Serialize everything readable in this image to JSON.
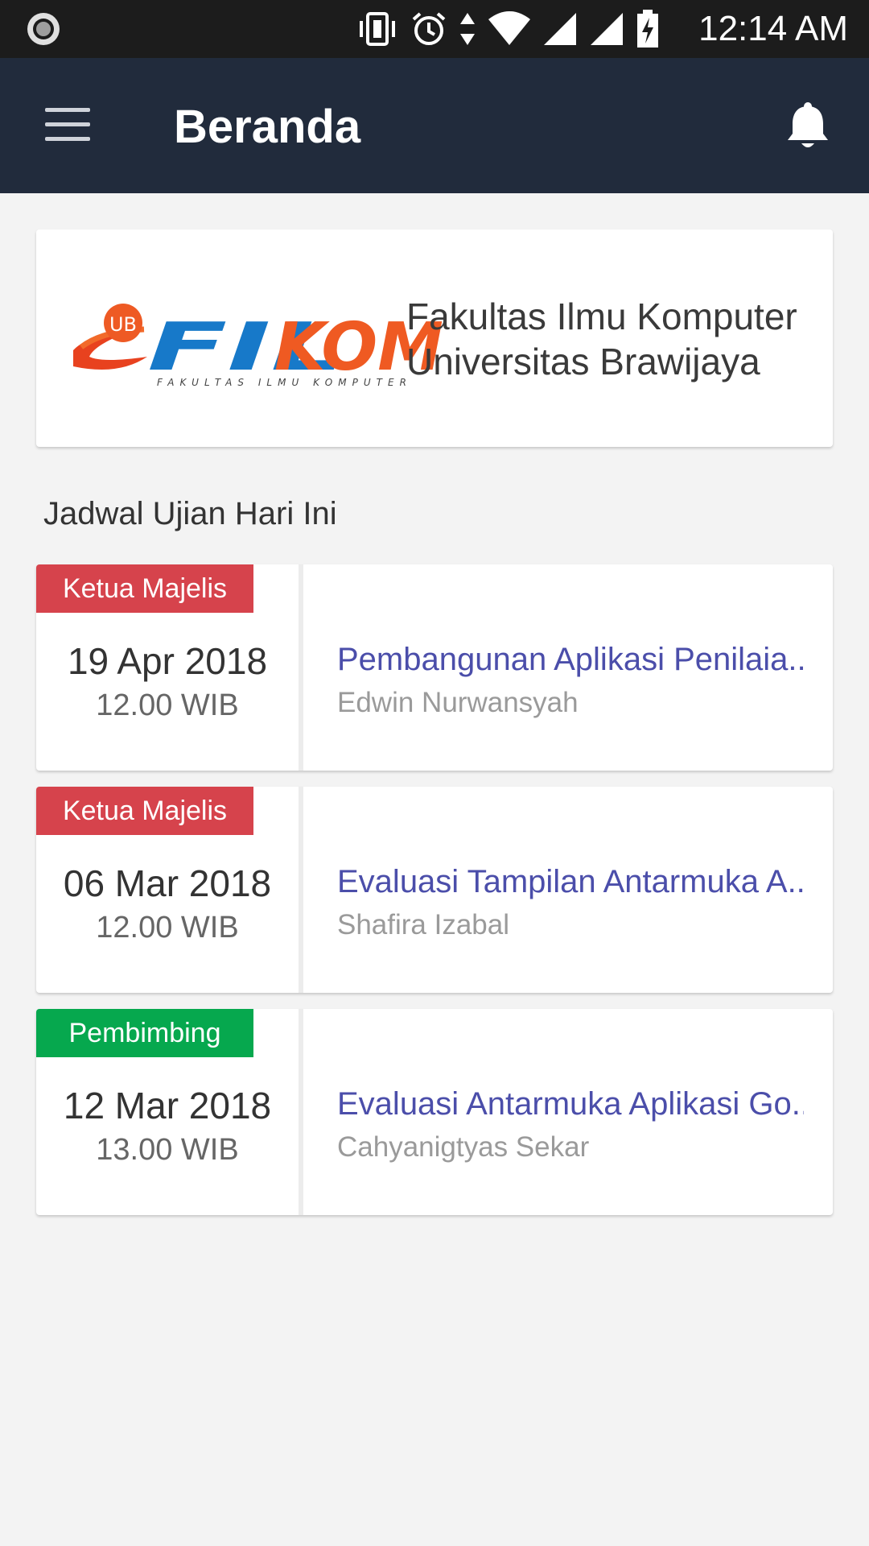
{
  "status_bar": {
    "time": "12:14 AM",
    "icons": [
      "record-icon",
      "vibrate-icon",
      "alarm-icon",
      "data-arrows-icon",
      "wifi-icon",
      "signal-icon",
      "signal-icon",
      "battery-charging-icon"
    ]
  },
  "app_bar": {
    "title": "Beranda",
    "menu_icon": "hamburger-menu-icon",
    "notification_icon": "bell-icon",
    "background": "#212b3c"
  },
  "banner": {
    "logo_text": "FILKOM",
    "logo_badge": "UB",
    "logo_subtext": "FAKULTAS ILMU KOMPUTER",
    "line1": "Fakultas Ilmu Komputer",
    "line2": "Universitas Brawijaya"
  },
  "section": {
    "title": "Jadwal Ujian Hari Ini"
  },
  "exams": [
    {
      "role": "Ketua Majelis",
      "role_color": "#d6434c",
      "date": "19 Apr 2018",
      "time": "12.00 WIB",
      "title": "Pembangunan Aplikasi Penilaia..",
      "name": "Edwin Nurwansyah"
    },
    {
      "role": "Ketua Majelis",
      "role_color": "#d6434c",
      "date": "06 Mar 2018",
      "time": "12.00 WIB",
      "title": "Evaluasi Tampilan Antarmuka A..",
      "name": "Shafira Izabal"
    },
    {
      "role": "Pembimbing",
      "role_color": "#06a84e",
      "date": "12 Mar 2018",
      "time": "13.00 WIB",
      "title": "Evaluasi Antarmuka Aplikasi Go..",
      "name": "Cahyanigtyas Sekar"
    }
  ]
}
